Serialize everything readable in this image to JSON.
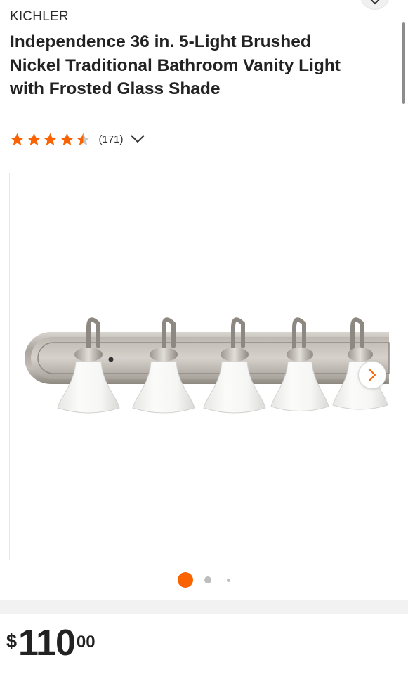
{
  "product": {
    "brand": "KICHLER",
    "title": "Independence 36 in. 5-Light Brushed Nickel Traditional Bathroom Vanity Light with Frosted Glass Shade",
    "rating": 4.5,
    "rating_max": 5,
    "review_count": "(171)"
  },
  "price": {
    "currency": "$",
    "dollars": "110",
    "cents": "00"
  },
  "gallery": {
    "image_subject": "brushed nickel 5-light vanity fixture with frosted glass shades",
    "total_images": 3,
    "active_index": 0
  },
  "colors": {
    "accent": "#f96302",
    "star": "#f96302",
    "star_empty": "#c8c8c8",
    "dot_inactive": "#bdbdbd",
    "text": "#222222"
  },
  "icons": {
    "top_button": "chevron-down-icon",
    "reviews_toggle": "chevron-down-icon",
    "next_image": "chevron-right-icon",
    "rating": "star-icon"
  }
}
